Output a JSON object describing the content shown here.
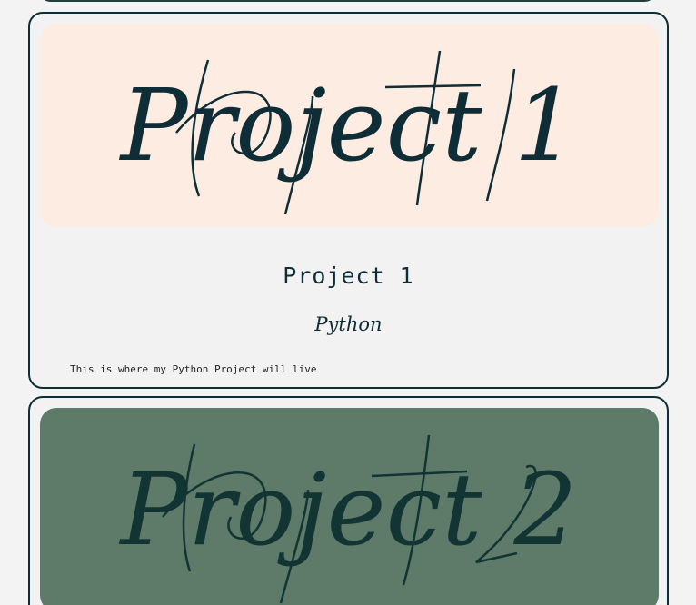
{
  "projects": [
    {
      "banner_text": "Project 1",
      "banner_color": "#fdece2",
      "title": "Project 1",
      "language": "Python",
      "description": "This is where my Python Project will live"
    },
    {
      "banner_text": "Project 2",
      "banner_color": "#5e7a69"
    }
  ],
  "colors": {
    "ink": "#0f2d36",
    "page_bg": "#f3f3f3",
    "card_bg": "#f2f2f2"
  }
}
